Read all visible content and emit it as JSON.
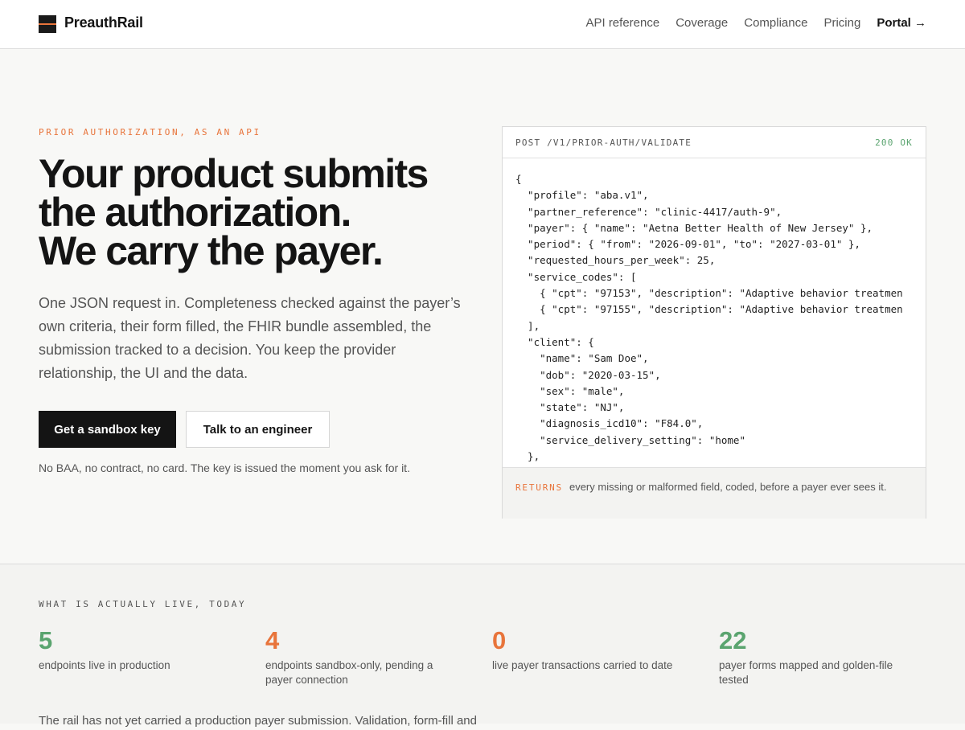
{
  "brand": {
    "name": "PreauthRail"
  },
  "nav": {
    "items": [
      "API reference",
      "Coverage",
      "Compliance",
      "Pricing"
    ],
    "portal": "Portal →"
  },
  "hero": {
    "eyebrow": "PRIOR AUTHORIZATION, AS AN API",
    "headline": [
      "Your product submits",
      "the authorization.",
      "We carry the payer."
    ],
    "lede": "One JSON request in. Completeness checked against the payer’s own criteria, their form filled, the FHIR bundle assembled, the submission tracked to a decision. You keep the provider relationship, the UI and the data.",
    "primary_cta": "Get a sandbox key",
    "secondary_cta": "Talk to an engineer",
    "fineprint": "No BAA, no contract, no card. The key is issued the moment you ask for it."
  },
  "code": {
    "method": "POST /V1/PRIOR-AUTH/VALIDATE",
    "status": "200 OK",
    "lines": [
      "{",
      "  \"profile\": \"aba.v1\",",
      "  \"partner_reference\": \"clinic-4417/auth-9\",",
      "  \"payer\": { \"name\": \"Aetna Better Health of New Jersey\" },",
      "  \"period\": { \"from\": \"2026-09-01\", \"to\": \"2027-03-01\" },",
      "  \"requested_hours_per_week\": 25,",
      "  \"service_codes\": [",
      "    { \"cpt\": \"97153\", \"description\": \"Adaptive behavior treatmen",
      "    { \"cpt\": \"97155\", \"description\": \"Adaptive behavior treatmen",
      "  ],",
      "  \"client\": {",
      "    \"name\": \"Sam Doe\",",
      "    \"dob\": \"2020-03-15\",",
      "    \"sex\": \"male\",",
      "    \"state\": \"NJ\",",
      "    \"diagnosis_icd10\": \"F84.0\",",
      "    \"service_delivery_setting\": \"home\"",
      "  },"
    ],
    "footer_tag": "RETURNS",
    "footer_text": "every missing or malformed field, coded, before a payer ever sees it."
  },
  "live": {
    "eyebrow": "WHAT IS ACTUALLY LIVE, TODAY",
    "stats": [
      {
        "value": "5",
        "label": "endpoints live in production",
        "color": "#5aa46f"
      },
      {
        "value": "4",
        "label": "endpoints sandbox-only, pending a payer connection",
        "color": "#e8743b"
      },
      {
        "value": "0",
        "label": "live payer transactions carried to date",
        "color": "#e8743b"
      },
      {
        "value": "22",
        "label": "payer forms mapped and golden-file tested",
        "color": "#5aa46f"
      }
    ],
    "note": "The rail has not yet carried a production payer submission. Validation, form-fill and"
  }
}
